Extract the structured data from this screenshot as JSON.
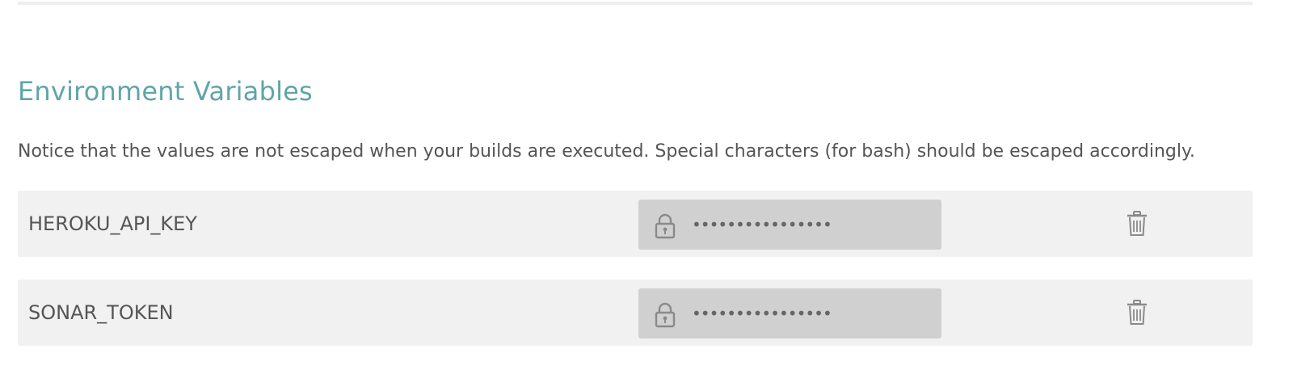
{
  "section": {
    "title": "Environment Variables",
    "notice": "Notice that the values are not escaped when your builds are executed. Special characters (for bash) should be escaped accordingly."
  },
  "env_vars": [
    {
      "name": "HEROKU_API_KEY",
      "value_masked": "••••••••••••••••",
      "value_icon": "lock-icon",
      "action_icon": "trash-icon"
    },
    {
      "name": "SONAR_TOKEN",
      "value_masked": "••••••••••••••••",
      "value_icon": "lock-icon",
      "action_icon": "trash-icon"
    }
  ],
  "colors": {
    "title": "#5fa5a8",
    "text": "#555555",
    "row_background": "#f1f1f1",
    "value_background": "#d0d0d0",
    "icon": "#8a8a8a"
  }
}
